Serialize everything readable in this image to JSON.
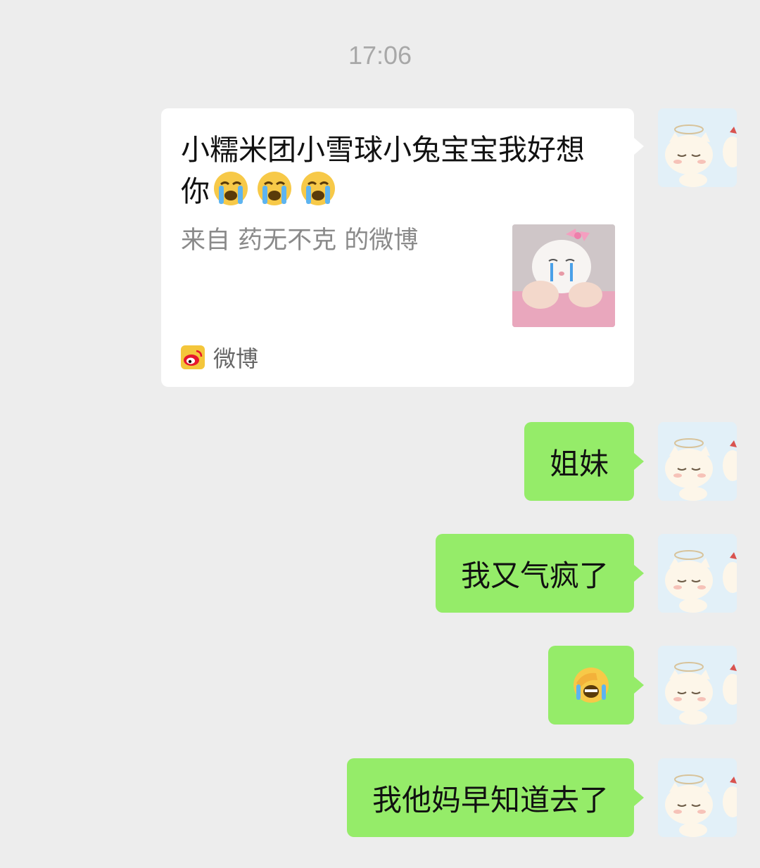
{
  "chat": {
    "timestamp": "17:06",
    "link_card": {
      "title": "小糯米团小雪球小兔宝宝我好想你",
      "title_emojis": [
        "loudly-crying-face",
        "loudly-crying-face",
        "loudly-crying-face"
      ],
      "subtitle": "来自 药无不克 的微博",
      "source_label": "微博",
      "source_icon": "weibo-logo-icon",
      "thumbnail": "crying-white-cat-with-pink-bow"
    },
    "messages": [
      {
        "text": "姐妹"
      },
      {
        "text": "我又气疯了"
      },
      {
        "emoji": "face-palm-laughing-emoji"
      },
      {
        "text": "我他妈早知道去了"
      }
    ],
    "colors": {
      "background": "#ededed",
      "sent_bubble": "#95ec69",
      "card": "#ffffff",
      "timestamp_text": "#a8a8a8"
    }
  }
}
